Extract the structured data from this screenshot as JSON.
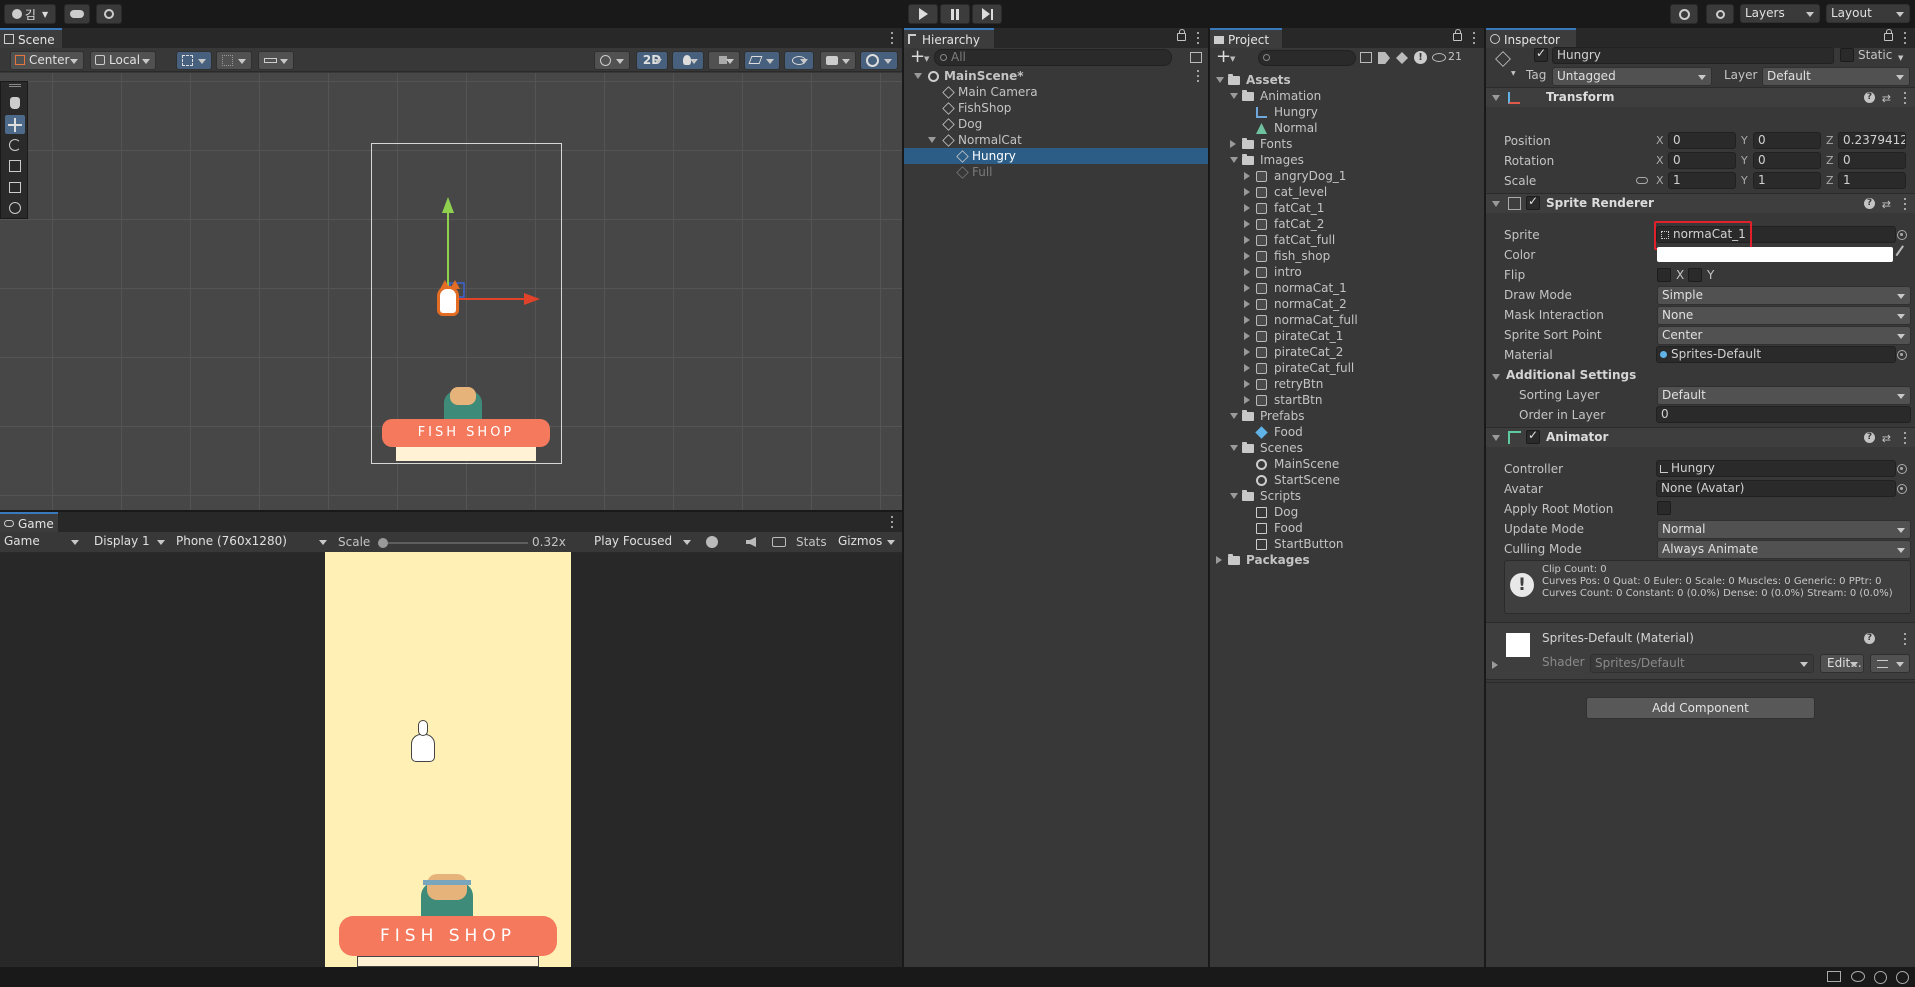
{
  "topbar": {
    "account_label": "김",
    "layers_label": "Layers",
    "layout_label": "Layout"
  },
  "scene": {
    "tab_label": "Scene",
    "pivot_label": "Center",
    "space_label": "Local",
    "mode_2d_label": "2D"
  },
  "game": {
    "tab_label": "Game",
    "view_label": "Game",
    "display_label": "Display 1",
    "resolution_label": "Phone (760x1280)",
    "scale_label": "Scale",
    "scale_value": "0.32x",
    "play_mode_label": "Play Focused",
    "stats_label": "Stats",
    "gizmos_label": "Gizmos",
    "sign_text": "FISH SHOP",
    "colors": {
      "background": "#fff1b6",
      "awning": "#f5795d"
    }
  },
  "scene_view": {
    "sign_text": "FISH SHOP"
  },
  "hierarchy": {
    "tab_label": "Hierarchy",
    "search_placeholder": "All",
    "items": [
      {
        "label": "MainScene*",
        "depth": 0,
        "expanded": true,
        "type": "scene"
      },
      {
        "label": "Main Camera",
        "depth": 1,
        "type": "object"
      },
      {
        "label": "FishShop",
        "depth": 1,
        "type": "object"
      },
      {
        "label": "Dog",
        "depth": 1,
        "type": "object"
      },
      {
        "label": "NormalCat",
        "depth": 1,
        "expanded": true,
        "type": "object"
      },
      {
        "label": "Hungry",
        "depth": 2,
        "selected": true,
        "type": "object"
      },
      {
        "label": "Full",
        "depth": 2,
        "disabled": true,
        "type": "object"
      }
    ]
  },
  "project": {
    "tab_label": "Project",
    "hidden_count": "21",
    "items": [
      {
        "label": "Assets",
        "depth": 0,
        "type": "folder",
        "expanded": true,
        "bold": true
      },
      {
        "label": "Animation",
        "depth": 1,
        "type": "folder",
        "expanded": true
      },
      {
        "label": "Hungry",
        "depth": 2,
        "type": "anim-controller"
      },
      {
        "label": "Normal",
        "depth": 2,
        "type": "anim-clip"
      },
      {
        "label": "Fonts",
        "depth": 1,
        "type": "folder",
        "collapsed": true
      },
      {
        "label": "Images",
        "depth": 1,
        "type": "folder",
        "expanded": true
      },
      {
        "label": "angryDog_1",
        "depth": 2,
        "type": "sprite"
      },
      {
        "label": "cat_level",
        "depth": 2,
        "type": "sprite"
      },
      {
        "label": "fatCat_1",
        "depth": 2,
        "type": "sprite"
      },
      {
        "label": "fatCat_2",
        "depth": 2,
        "type": "sprite"
      },
      {
        "label": "fatCat_full",
        "depth": 2,
        "type": "sprite"
      },
      {
        "label": "fish_shop",
        "depth": 2,
        "type": "sprite"
      },
      {
        "label": "intro",
        "depth": 2,
        "type": "sprite"
      },
      {
        "label": "normaCat_1",
        "depth": 2,
        "type": "sprite"
      },
      {
        "label": "normaCat_2",
        "depth": 2,
        "type": "sprite"
      },
      {
        "label": "normaCat_full",
        "depth": 2,
        "type": "sprite"
      },
      {
        "label": "pirateCat_1",
        "depth": 2,
        "type": "sprite"
      },
      {
        "label": "pirateCat_2",
        "depth": 2,
        "type": "sprite"
      },
      {
        "label": "pirateCat_full",
        "depth": 2,
        "type": "sprite"
      },
      {
        "label": "retryBtn",
        "depth": 2,
        "type": "sprite"
      },
      {
        "label": "startBtn",
        "depth": 2,
        "type": "sprite"
      },
      {
        "label": "Prefabs",
        "depth": 1,
        "type": "folder",
        "expanded": true
      },
      {
        "label": "Food",
        "depth": 2,
        "type": "prefab"
      },
      {
        "label": "Scenes",
        "depth": 1,
        "type": "folder",
        "expanded": true
      },
      {
        "label": "MainScene",
        "depth": 2,
        "type": "scene"
      },
      {
        "label": "StartScene",
        "depth": 2,
        "type": "scene"
      },
      {
        "label": "Scripts",
        "depth": 1,
        "type": "folder",
        "expanded": true
      },
      {
        "label": "Dog",
        "depth": 2,
        "type": "script"
      },
      {
        "label": "Food",
        "depth": 2,
        "type": "script"
      },
      {
        "label": "StartButton",
        "depth": 2,
        "type": "script"
      },
      {
        "label": "Packages",
        "depth": 0,
        "type": "folder",
        "collapsed": true,
        "bold": true
      }
    ]
  },
  "inspector": {
    "tab_label": "Inspector",
    "object_name": "Hungry",
    "static_label": "Static",
    "tag_label": "Tag",
    "tag_value": "Untagged",
    "layer_label": "Layer",
    "layer_value": "Default",
    "transform": {
      "title": "Transform",
      "position_label": "Position",
      "rotation_label": "Rotation",
      "scale_label": "Scale",
      "position": {
        "x": "0",
        "y": "0",
        "z": "0.2379412"
      },
      "rotation": {
        "x": "0",
        "y": "0",
        "z": "0"
      },
      "scale": {
        "x": "1",
        "y": "1",
        "z": "1"
      },
      "axis_x": "X",
      "axis_y": "Y",
      "axis_z": "Z"
    },
    "sprite_renderer": {
      "title": "Sprite Renderer",
      "sprite_label": "Sprite",
      "sprite_value": "normaCat_1",
      "color_label": "Color",
      "flip_label": "Flip",
      "flip_x": "X",
      "flip_y": "Y",
      "draw_mode_label": "Draw Mode",
      "draw_mode_value": "Simple",
      "mask_label": "Mask Interaction",
      "mask_value": "None",
      "sort_point_label": "Sprite Sort Point",
      "sort_point_value": "Center",
      "material_label": "Material",
      "material_value": "Sprites-Default",
      "additional_label": "Additional Settings",
      "sorting_layer_label": "Sorting Layer",
      "sorting_layer_value": "Default",
      "order_label": "Order in Layer",
      "order_value": "0",
      "highlight_color": "#e0202a"
    },
    "animator": {
      "title": "Animator",
      "controller_label": "Controller",
      "controller_value": "Hungry",
      "avatar_label": "Avatar",
      "avatar_value": "None (Avatar)",
      "root_motion_label": "Apply Root Motion",
      "update_label": "Update Mode",
      "update_value": "Normal",
      "culling_label": "Culling Mode",
      "culling_value": "Always Animate",
      "info_line1": "Clip Count: 0",
      "info_line2": "Curves Pos: 0 Quat: 0 Euler: 0 Scale: 0 Muscles: 0 Generic: 0 PPtr: 0",
      "info_line3": "Curves Count: 0 Constant: 0 (0.0%) Dense: 0 (0.0%) Stream: 0 (0.0%)"
    },
    "material": {
      "title": "Sprites-Default (Material)",
      "shader_label": "Shader",
      "shader_value": "Sprites/Default",
      "edit_label": "Edit..."
    },
    "add_component_label": "Add Component"
  }
}
